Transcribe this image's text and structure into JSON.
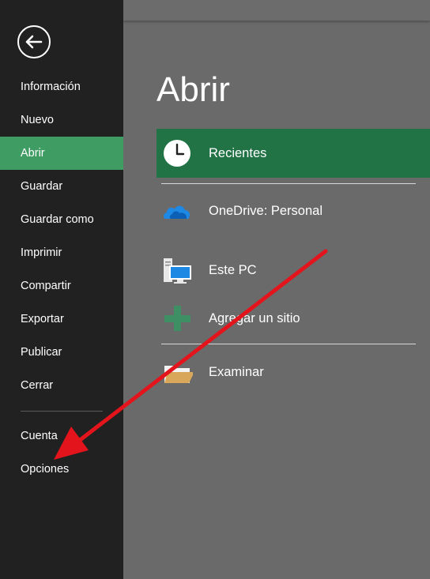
{
  "sidebar": {
    "items": [
      {
        "label": "Información"
      },
      {
        "label": "Nuevo"
      },
      {
        "label": "Abrir",
        "active": true
      },
      {
        "label": "Guardar"
      },
      {
        "label": "Guardar como"
      },
      {
        "label": "Imprimir"
      },
      {
        "label": "Compartir"
      },
      {
        "label": "Exportar"
      },
      {
        "label": "Publicar"
      },
      {
        "label": "Cerrar"
      },
      {
        "label": "Cuenta"
      },
      {
        "label": "Opciones"
      }
    ]
  },
  "main": {
    "title": "Abrir",
    "locations": [
      {
        "label": "Recientes",
        "icon": "clock-icon",
        "active": true
      },
      {
        "label": "OneDrive: Personal",
        "icon": "onedrive-cloud-icon"
      },
      {
        "label": "Este PC",
        "icon": "computer-icon"
      },
      {
        "label": "Agregar un sitio",
        "icon": "plus-icon"
      },
      {
        "label": "Examinar",
        "icon": "folder-icon"
      }
    ]
  },
  "colors": {
    "sidebar_bg": "#212121",
    "sidebar_active": "#3f9d64",
    "content_bg": "#6a6a6a",
    "location_active": "#217346",
    "annotation_arrow": "#e3141b"
  }
}
